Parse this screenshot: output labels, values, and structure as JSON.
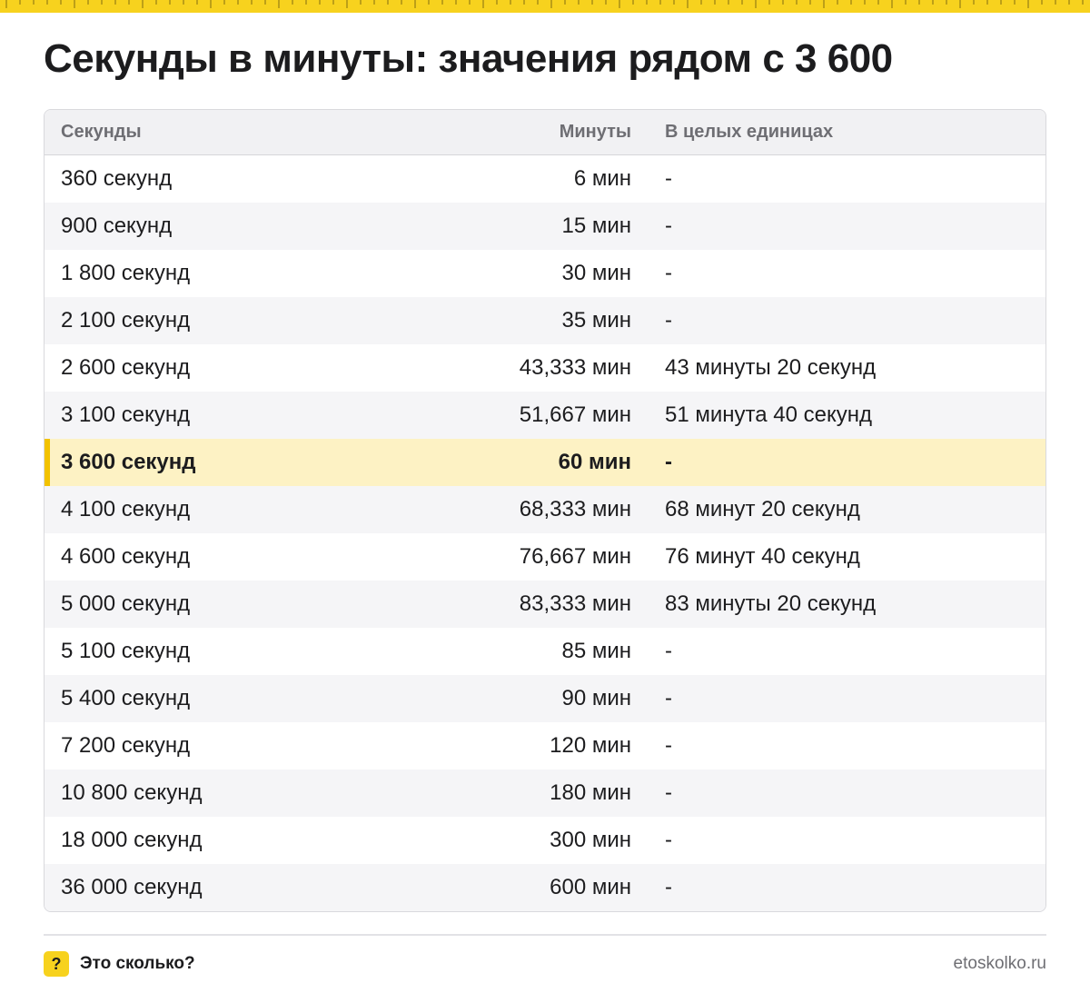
{
  "title": "Секунды в минуты: значения рядом с 3 600",
  "colors": {
    "accent": "#f7d21e",
    "highlight_bg": "#fdf2c4",
    "highlight_bar": "#f2c200"
  },
  "table": {
    "headers": [
      "Секунды",
      "Минуты",
      "В целых единицах"
    ],
    "highlight_index": 6,
    "rows": [
      [
        "360 секунд",
        "6 мин",
        "-"
      ],
      [
        "900 секунд",
        "15 мин",
        "-"
      ],
      [
        "1 800 секунд",
        "30 мин",
        "-"
      ],
      [
        "2 100 секунд",
        "35 мин",
        "-"
      ],
      [
        "2 600 секунд",
        "43,333 мин",
        "43 минуты 20 секунд"
      ],
      [
        "3 100 секунд",
        "51,667 мин",
        "51 минута 40 секунд"
      ],
      [
        "3 600 секунд",
        "60 мин",
        "-"
      ],
      [
        "4 100 секунд",
        "68,333 мин",
        "68 минут 20 секунд"
      ],
      [
        "4 600 секунд",
        "76,667 мин",
        "76 минут 40 секунд"
      ],
      [
        "5 000 секунд",
        "83,333 мин",
        "83 минуты 20 секунд"
      ],
      [
        "5 100 секунд",
        "85 мин",
        "-"
      ],
      [
        "5 400 секунд",
        "90 мин",
        "-"
      ],
      [
        "7 200 секунд",
        "120 мин",
        "-"
      ],
      [
        "10 800 секунд",
        "180 мин",
        "-"
      ],
      [
        "18 000 секунд",
        "300 мин",
        "-"
      ],
      [
        "36 000 секунд",
        "600 мин",
        "-"
      ]
    ]
  },
  "footer": {
    "brand_icon": "question-mark-icon",
    "brand_glyph": "?",
    "brand_name": "Это сколько?",
    "site": "etoskolko.ru"
  }
}
